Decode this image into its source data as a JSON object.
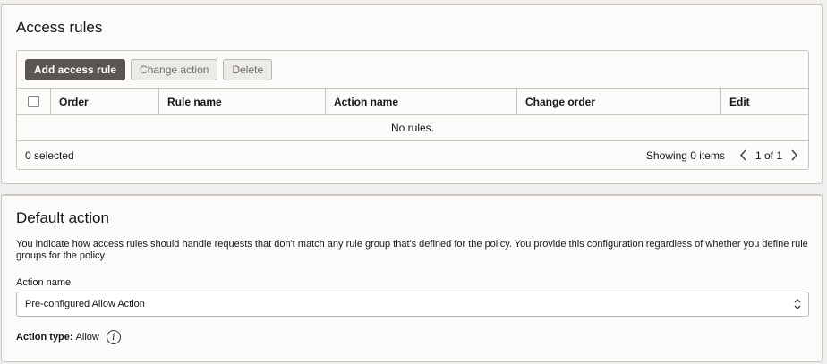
{
  "access_rules": {
    "title": "Access rules",
    "toolbar": {
      "add_label": "Add access rule",
      "change_label": "Change action",
      "delete_label": "Delete"
    },
    "columns": [
      "Order",
      "Rule name",
      "Action name",
      "Change order",
      "Edit"
    ],
    "empty_text": "No rules.",
    "footer": {
      "selected": "0 selected",
      "showing": "Showing 0 items",
      "page": "1 of 1"
    }
  },
  "default_action": {
    "title": "Default action",
    "description": "You indicate how access rules should handle requests that don't match any rule group that's defined for the policy. You provide this configuration regardless of whether you define rule groups for the policy.",
    "field_label": "Action name",
    "select_value": "Pre-configured Allow Action",
    "action_type_label": "Action type:",
    "action_type_value": "Allow"
  },
  "icons": {
    "prev": "chevron-left-icon",
    "next": "chevron-right-icon",
    "select_caret": "updown-caret-icon",
    "info": "info-icon"
  },
  "colors": {
    "primary_button": "#5b5652",
    "border": "#c9c6c2",
    "background": "#f1efed",
    "panel": "#fcfbfa"
  }
}
